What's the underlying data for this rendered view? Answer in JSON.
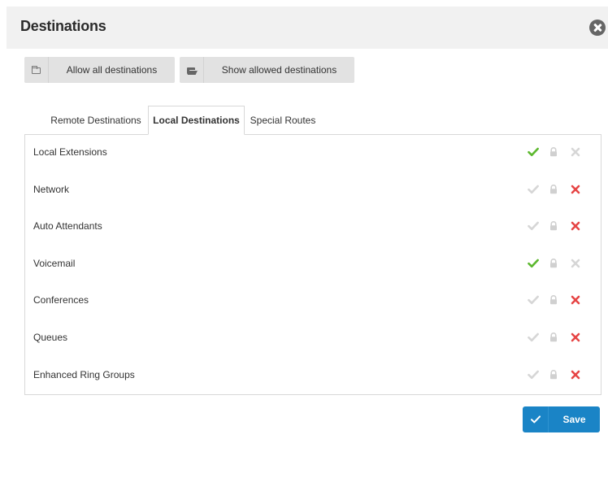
{
  "modal": {
    "title": "Destinations"
  },
  "toolbar": {
    "allow_all_label": "Allow all destinations",
    "show_allowed_label": "Show allowed destinations"
  },
  "tabs": [
    {
      "label": "Remote Destinations",
      "active": false
    },
    {
      "label": "Local Destinations",
      "active": true
    },
    {
      "label": "Special Routes",
      "active": false
    }
  ],
  "destinations": [
    {
      "label": "Local Extensions",
      "state": "allowed"
    },
    {
      "label": "Network",
      "state": "denied"
    },
    {
      "label": "Auto Attendants",
      "state": "denied"
    },
    {
      "label": "Voicemail",
      "state": "allowed"
    },
    {
      "label": "Conferences",
      "state": "denied"
    },
    {
      "label": "Queues",
      "state": "denied"
    },
    {
      "label": "Enhanced Ring Groups",
      "state": "denied"
    }
  ],
  "colors": {
    "allowed_check": "#5cb82e",
    "denied_x": "#e64545",
    "inactive_icon": "#d6d6d6",
    "lock_icon": "#d0d0d0",
    "save_button": "#1a84c6"
  },
  "footer": {
    "save_label": "Save"
  }
}
